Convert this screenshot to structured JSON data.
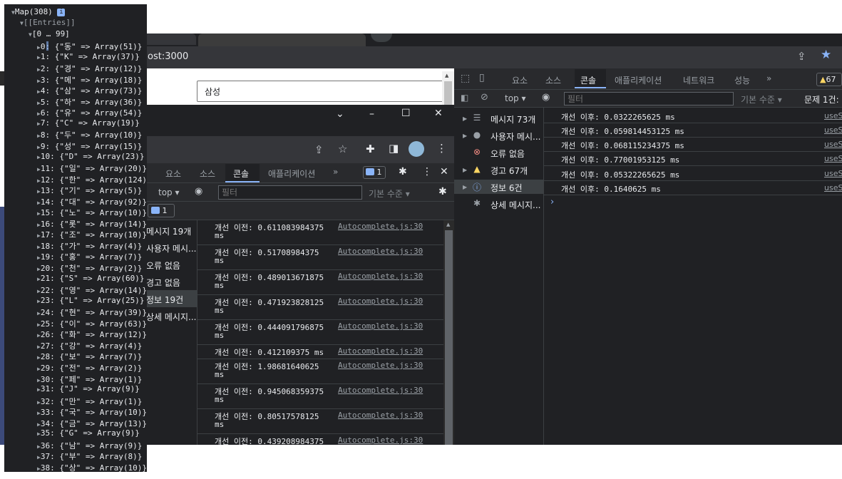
{
  "back_window": {
    "url_fragment": "ost:3000",
    "search_value": "삼성",
    "devtools": {
      "tabs": [
        "요소",
        "소스",
        "콘솔",
        "애플리케이션",
        "네트워크",
        "성능",
        "»"
      ],
      "active_tab": "콘솔",
      "warning_count": "67",
      "context": "top ▾",
      "filter_placeholder": "필터",
      "level": "기본 수준 ▾",
      "issues": "문제 1건:",
      "sidebar": [
        {
          "label": "메시지 73개",
          "icon": "list-icon"
        },
        {
          "label": "사용자 메시...",
          "icon": "user-icon"
        },
        {
          "label": "오류 없음",
          "icon": "error-icon"
        },
        {
          "label": "경고 67개",
          "icon": "warning-icon"
        },
        {
          "label": "정보 6건",
          "icon": "info-icon"
        },
        {
          "label": "상세 메시지...",
          "icon": "bug-icon"
        }
      ],
      "logs": [
        {
          "text": "개선 이후: 0.0322265625 ms",
          "src": "useS"
        },
        {
          "text": "개선 이후: 0.059814453125 ms",
          "src": "useS"
        },
        {
          "text": "개선 이후: 0.068115234375 ms",
          "src": "useS"
        },
        {
          "text": "개선 이후: 0.77001953125 ms",
          "src": "useS"
        },
        {
          "text": "개선 이후: 0.05322265625 ms",
          "src": "useS"
        },
        {
          "text": "개선 이후: 0.1640625 ms",
          "src": "useS"
        }
      ],
      "prompt": "›"
    }
  },
  "mid_window": {
    "window_buttons": [
      "⌄",
      "–",
      "☐",
      "✕"
    ],
    "devtools": {
      "tabs": [
        "요소",
        "소스",
        "콘솔",
        "애플리케이션",
        "»"
      ],
      "active_tab": "콘솔",
      "msg_badge": "1",
      "context": "top ▾",
      "filter_placeholder": "필터",
      "level": "기본 수준 ▾",
      "issues_badge": "1",
      "sidebar": [
        "메시지 19개",
        "사용자 메시...",
        "오류 없음",
        "경고 없음",
        "정보 19건",
        "상세 메시지..."
      ],
      "logs": [
        {
          "text": "개선 이전: 0.611083984375",
          "tail": "ms",
          "src": "Autocomplete.js:30"
        },
        {
          "text": "개선 이전: 0.51708984375",
          "tail": "ms",
          "src": "Autocomplete.js:30"
        },
        {
          "text": "개선 이전: 0.489013671875",
          "tail": "ms",
          "src": "Autocomplete.js:30"
        },
        {
          "text": "개선 이전: 0.471923828125",
          "tail": "ms",
          "src": "Autocomplete.js:30"
        },
        {
          "text": "개선 이전: 0.444091796875",
          "tail": "ms",
          "src": "Autocomplete.js:30"
        },
        {
          "text": "개선 이전: 0.412109375 ms",
          "tail": "",
          "src": "Autocomplete.js:30"
        },
        {
          "text": "개선 이전: 1.98681640625",
          "tail": "ms",
          "src": "Autocomplete.js:30"
        },
        {
          "text": "개선 이전: 0.945068359375",
          "tail": "ms",
          "src": "Autocomplete.js:30"
        },
        {
          "text": "개선 이전: 0.80517578125",
          "tail": "ms",
          "src": "Autocomplete.js:30"
        },
        {
          "text": "개선 이전: 0.439208984375",
          "tail": "",
          "src": "Autocomplete.js:30"
        }
      ]
    }
  },
  "tree": {
    "root": "Map(308)",
    "info": "i",
    "entries_label": "[[Entries]]",
    "range_label": "[0 … 99]",
    "items": [
      "0: {\"동\" => Array(51)}",
      "1: {\"K\" => Array(37)}",
      "2: {\"경\" => Array(12)}",
      "3: {\"메\" => Array(18)}",
      "4: {\"삼\" => Array(73)}",
      "5: {\"하\" => Array(36)}",
      "6: {\"유\" => Array(54)}",
      "7: {\"C\" => Array(19)}",
      "8: {\"두\" => Array(10)}",
      "9: {\"성\" => Array(15)}",
      "10: {\"D\" => Array(23)}",
      "11: {\"일\" => Array(20)}",
      "12: {\"한\" => Array(124)}",
      "13: {\"기\" => Array(5)}",
      "14: {\"대\" => Array(92)}",
      "15: {\"노\" => Array(10)}",
      "16: {\"롯\" => Array(14)}",
      "17: {\"조\" => Array(10)}",
      "18: {\"가\" => Array(4)}",
      "19: {\"홍\" => Array(7)}",
      "20: {\"천\" => Array(2)}",
      "21: {\"S\" => Array(60)}",
      "22: {\"영\" => Array(14)}",
      "23: {\"L\" => Array(25)}",
      "24: {\"현\" => Array(39)}",
      "25: {\"이\" => Array(63)}",
      "26: {\"화\" => Array(12)}",
      "27: {\"강\" => Array(4)}",
      "28: {\"보\" => Array(7)}",
      "29: {\"전\" => Array(2)}",
      "30: {\"페\" => Array(1)}",
      "31: {\"J\" => Array(9)}",
      "32: {\"만\" => Array(1)}",
      "33: {\"국\" => Array(10)}",
      "34: {\"금\" => Array(13)}",
      "35: {\"G\" => Array(9)}",
      "36: {\"남\" => Array(9)}",
      "37: {\"부\" => Array(8)}",
      "38: {\"상\" => Array(10)}"
    ]
  }
}
